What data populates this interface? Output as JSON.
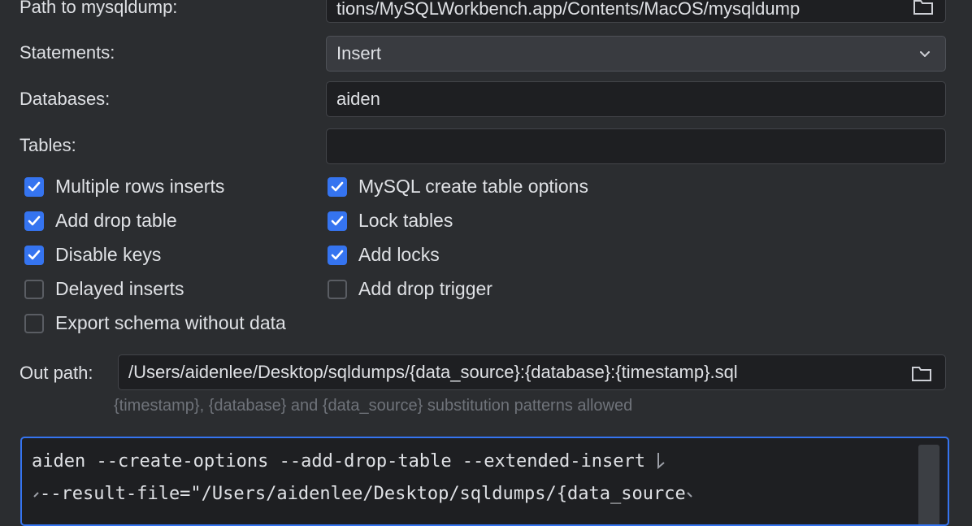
{
  "labels": {
    "path_to_mysqldump": "Path to mysqldump:",
    "statements": "Statements:",
    "databases": "Databases:",
    "tables": "Tables:",
    "out_path": "Out path:"
  },
  "fields": {
    "mysqldump_path": "tions/MySQLWorkbench.app/Contents/MacOS/mysqldump",
    "statements_value": "Insert",
    "databases_value": "aiden",
    "tables_value": "",
    "out_path_value": "/Users/aidenlee/Desktop/sqldumps/{data_source}:{database}:{timestamp}.sql"
  },
  "options_left": [
    {
      "label": "Multiple rows inserts",
      "checked": true
    },
    {
      "label": "Add drop table",
      "checked": true
    },
    {
      "label": "Disable keys",
      "checked": true
    },
    {
      "label": "Delayed inserts",
      "checked": false
    },
    {
      "label": "Export schema without data",
      "checked": false
    }
  ],
  "options_right": [
    {
      "label": "MySQL create table options",
      "checked": true
    },
    {
      "label": "Lock tables",
      "checked": true
    },
    {
      "label": "Add locks",
      "checked": true
    },
    {
      "label": "Add drop trigger",
      "checked": false
    }
  ],
  "hint": "{timestamp}, {database} and {data_source} substitution patterns allowed",
  "command": {
    "line1": "aiden --create-options --add-drop-table --extended-insert",
    "line2": "--result-file=\"/Users/aidenlee/Desktop/sqldumps/{data_source"
  },
  "colors": {
    "accent": "#3574f0",
    "background": "#2b2d30",
    "field_background": "#1e1f22"
  },
  "icons": {
    "browse": "folder-icon",
    "dropdown": "chevron-down-icon",
    "check": "checkmark-icon",
    "wrap": "soft-wrap-icon"
  }
}
